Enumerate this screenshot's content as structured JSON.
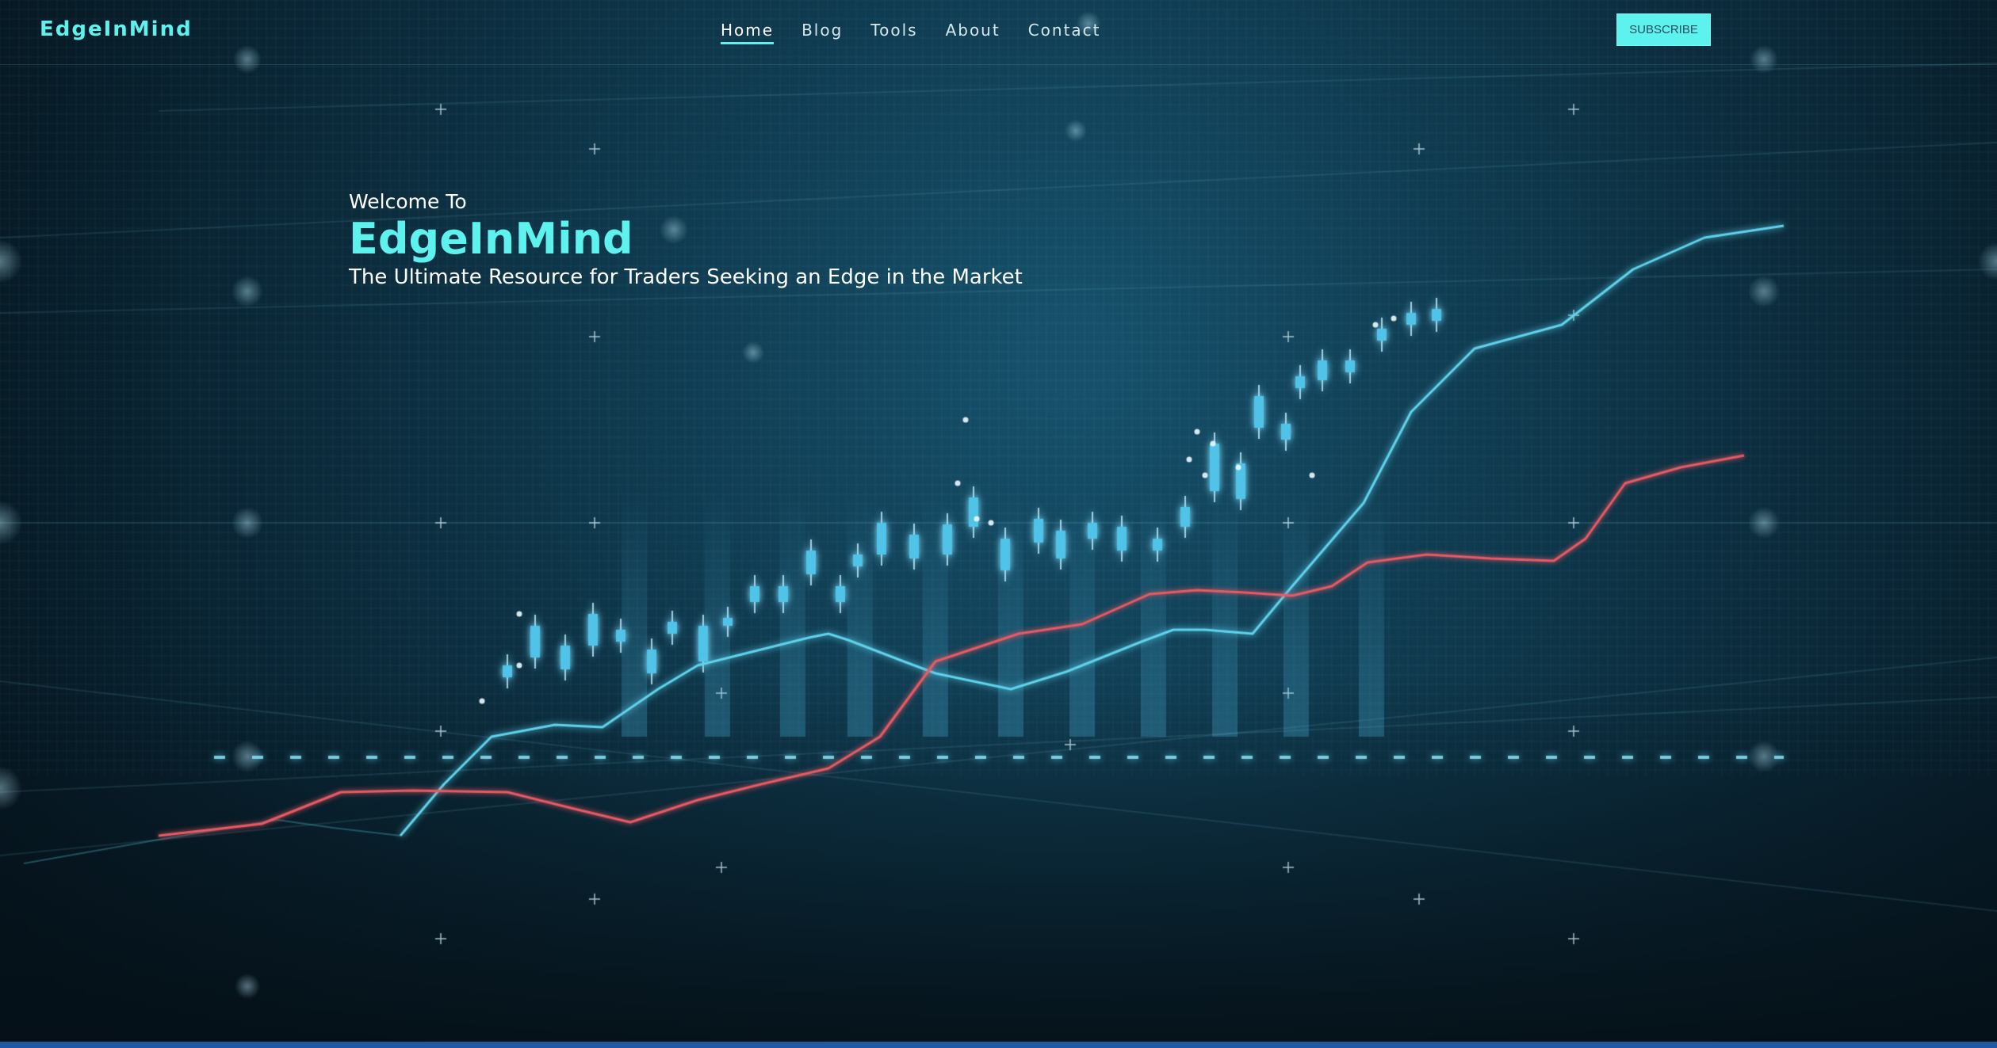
{
  "nav": {
    "logo": "EdgeInMind",
    "links": [
      {
        "label": "Home",
        "active": true
      },
      {
        "label": "Blog",
        "active": false
      },
      {
        "label": "Tools",
        "active": false
      },
      {
        "label": "About",
        "active": false
      },
      {
        "label": "Contact",
        "active": false
      }
    ],
    "subscribe_label": "SUBSCRIBE"
  },
  "hero": {
    "welcome": "Welcome To",
    "brand": "EdgeInMind",
    "tagline": "The Ultimate Resource for Traders Seeking an Edge in the Market"
  },
  "colors": {
    "accent": "#5ef2ee",
    "background": "#06161f",
    "candle": "#4fc3e8",
    "cyan_line": "#5fd3ec",
    "red_line": "#e85a64",
    "bottom_strip": "#1f58a3"
  }
}
